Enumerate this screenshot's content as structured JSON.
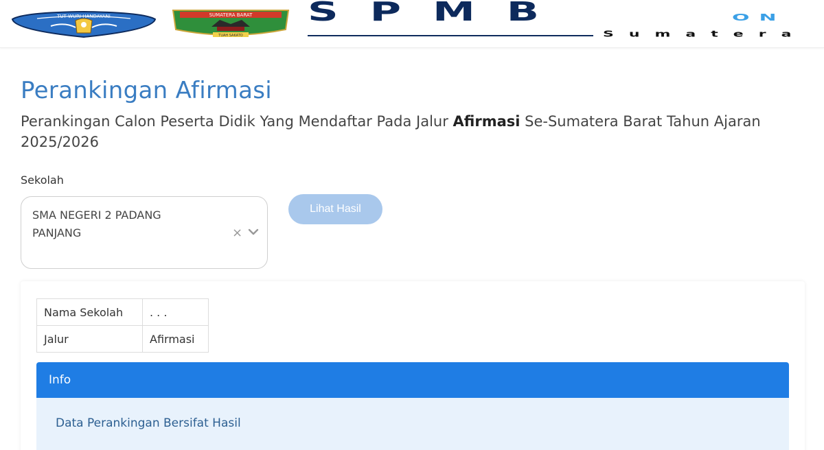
{
  "header": {
    "logo_left_text": "TUT WURI HANDAYANI",
    "logo_sumbar_text": "SUMATERA BARAT",
    "logo_sumbar_sub": "TUAH SAKATO",
    "brand_main": "SPMB",
    "brand_on": "ON",
    "brand_sub": "Sumatera"
  },
  "page": {
    "title": "Perankingan Afirmasi",
    "subtitle_before": "Perankingan Calon Peserta Didik Yang Mendaftar Pada Jalur ",
    "subtitle_bold": "Afirmasi",
    "subtitle_after": " Se-Sumatera Barat Tahun Ajaran 2025/2026"
  },
  "form": {
    "sekolah_label": "Sekolah",
    "sekolah_value": "SMA NEGERI 2 PADANG PANJANG",
    "clear_glyph": "×",
    "submit_label": "Lihat Hasil"
  },
  "info_table": {
    "rows": [
      {
        "key": "Nama Sekolah",
        "value": ". . ."
      },
      {
        "key": "Jalur",
        "value": "Afirmasi"
      }
    ]
  },
  "alert": {
    "title": "Info",
    "message": "Data Perankingan Bersifat Hasil"
  },
  "colors": {
    "title_blue": "#3a7dc2",
    "alert_blue": "#1f7de4",
    "alert_bg": "#e8f2fc",
    "button_disabled": "#a9c8ec",
    "brand_navy": "#0d2a5c"
  }
}
